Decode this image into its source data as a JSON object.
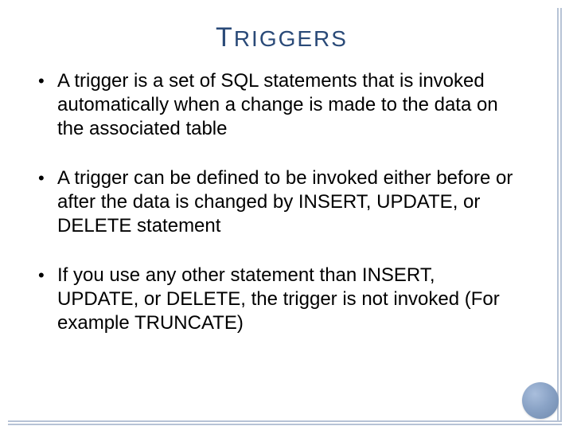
{
  "title_text": "RIGGERS",
  "title_initial": "T",
  "bullets": {
    "b0": "A trigger is a set of SQL statements that is invoked automatically when a change is made to the data on the associated table",
    "b1": "A trigger can be defined to be invoked either before or after the data is changed by INSERT, UPDATE, or DELETE statement",
    "b2": "If you use any other statement than INSERT, UPDATE, or DELETE, the trigger is not invoked (For example TRUNCATE)"
  }
}
